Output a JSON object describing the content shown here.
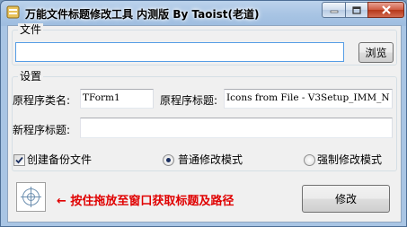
{
  "window": {
    "title": "万能文件标题修改工具 内测版 By Taoist(老道)"
  },
  "file_group": {
    "title": "文件",
    "path_value": "",
    "browse_label": "浏览"
  },
  "settings_group": {
    "title": "设置",
    "class_name_label": "原程序类名:",
    "class_name_value": "TForm1",
    "orig_title_label": "原程序标题:",
    "orig_title_value": "Icons from File - V3Setup_IMM_N",
    "new_title_label": "新程序标题:",
    "new_title_value": "",
    "backup_label": "创建备份文件",
    "backup_checked": true,
    "mode_normal_label": "普通修改模式",
    "mode_force_label": "强制修改模式",
    "selected_mode": "normal"
  },
  "footer": {
    "hint": "← 按住拖放至窗口获取标题及路径",
    "modify_label": "修改"
  },
  "colors": {
    "accent_red": "#e00000",
    "check": "#1b2f60"
  },
  "icons": [
    "app-icon",
    "minimize-icon",
    "maximize-icon",
    "close-icon",
    "crosshair-icon",
    "checkmark-icon"
  ]
}
